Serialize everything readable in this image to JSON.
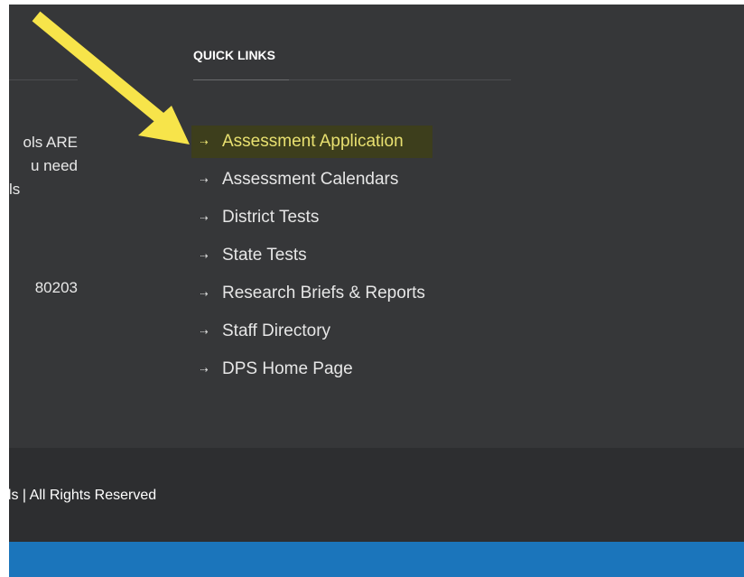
{
  "left_column": {
    "lines": [
      "ols ARE",
      "u need",
      "ls"
    ],
    "zip": "80203"
  },
  "quick_links": {
    "title": "QUICK LINKS",
    "items": [
      {
        "label": "Assessment Application",
        "highlighted": true
      },
      {
        "label": "Assessment Calendars",
        "highlighted": false
      },
      {
        "label": "District Tests",
        "highlighted": false
      },
      {
        "label": "State Tests",
        "highlighted": false
      },
      {
        "label": "Research Briefs & Reports",
        "highlighted": false
      },
      {
        "label": "Staff Directory",
        "highlighted": false
      },
      {
        "label": "DPS Home Page",
        "highlighted": false
      }
    ],
    "arrow_glyph": "⇢"
  },
  "footer": {
    "copyright": "ols | All Rights Reserved"
  },
  "colors": {
    "footer_bg": "#363739",
    "bottom_bar_bg": "#2d2e30",
    "blue_bar_bg": "#1b75bb",
    "highlight_text": "#e8e070",
    "highlight_bg": "#3d3e1c",
    "annotation_arrow": "#f7e44a"
  },
  "icons": {
    "link_arrow": "dashed-right-arrow-icon",
    "annotation": "yellow-pointer-arrow-icon"
  }
}
